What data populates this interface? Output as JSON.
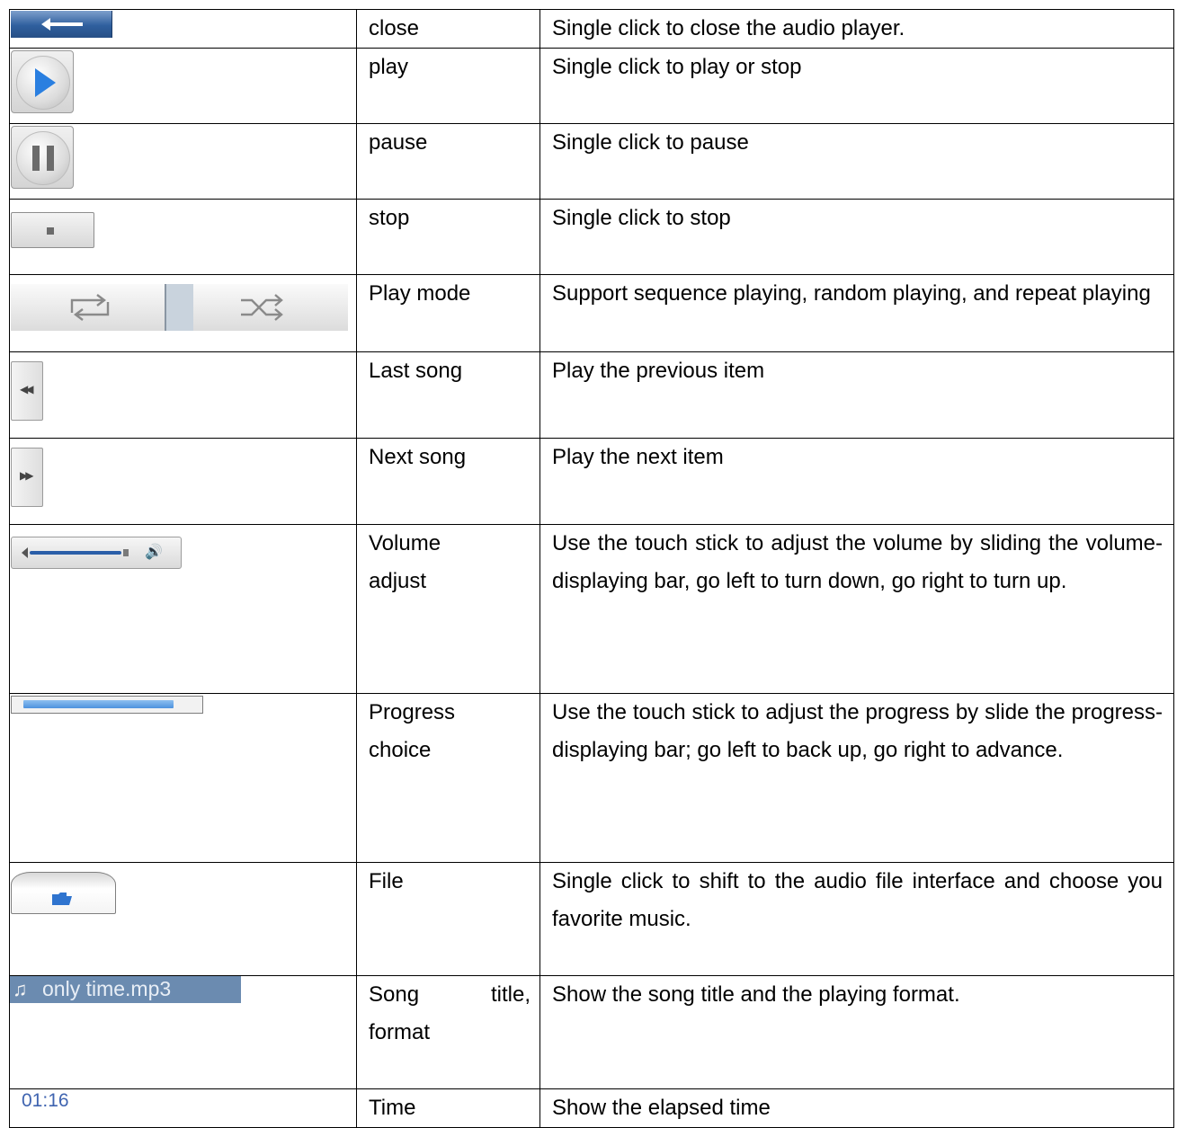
{
  "rows": [
    {
      "icon": "close-arrow-icon",
      "name": "close",
      "desc": "Single click to close the audio player."
    },
    {
      "icon": "play-icon",
      "name": "play",
      "desc": "Single click to play or stop"
    },
    {
      "icon": "pause-icon",
      "name": "pause",
      "desc": "Single click to pause"
    },
    {
      "icon": "stop-icon",
      "name": "stop",
      "desc": "Single click to stop"
    },
    {
      "icon": "repeat-shuffle-icon",
      "name": "Play mode",
      "desc": "Support sequence playing, random playing, and repeat playing"
    },
    {
      "icon": "previous-icon",
      "name": "Last song",
      "desc": "Play the previous item"
    },
    {
      "icon": "next-icon",
      "name": "Next song",
      "desc": "Play the next item"
    },
    {
      "icon": "volume-slider-icon",
      "name_lines": [
        "Volume",
        "adjust"
      ],
      "desc": "Use the touch stick to adjust the volume by sliding the volume-displaying bar, go left to turn down, go right to turn up."
    },
    {
      "icon": "progress-bar-icon",
      "progress": 0.88,
      "name_lines": [
        "Progress",
        "choice"
      ],
      "desc": "Use the touch stick to adjust the progress by slide the progress-displaying bar; go left to back up, go right to advance."
    },
    {
      "icon": "folder-icon",
      "name": "File",
      "desc": "Single click to shift to the audio file interface and choose you favorite music."
    },
    {
      "icon": "music-note-icon",
      "song_label": "only time.mp3",
      "name_lines": [
        "Song title,",
        "format"
      ],
      "desc": "Show the song title and the playing format."
    },
    {
      "time_label": "01:16",
      "name": "Time",
      "desc": "Show the elapsed time"
    }
  ],
  "colors": {
    "close_button": "#2f5f9e",
    "play_triangle": "#2a7fe0",
    "progress_fill": "#4d92de",
    "song_strip": "#6b8bb0",
    "time_text": "#3f64b0"
  }
}
